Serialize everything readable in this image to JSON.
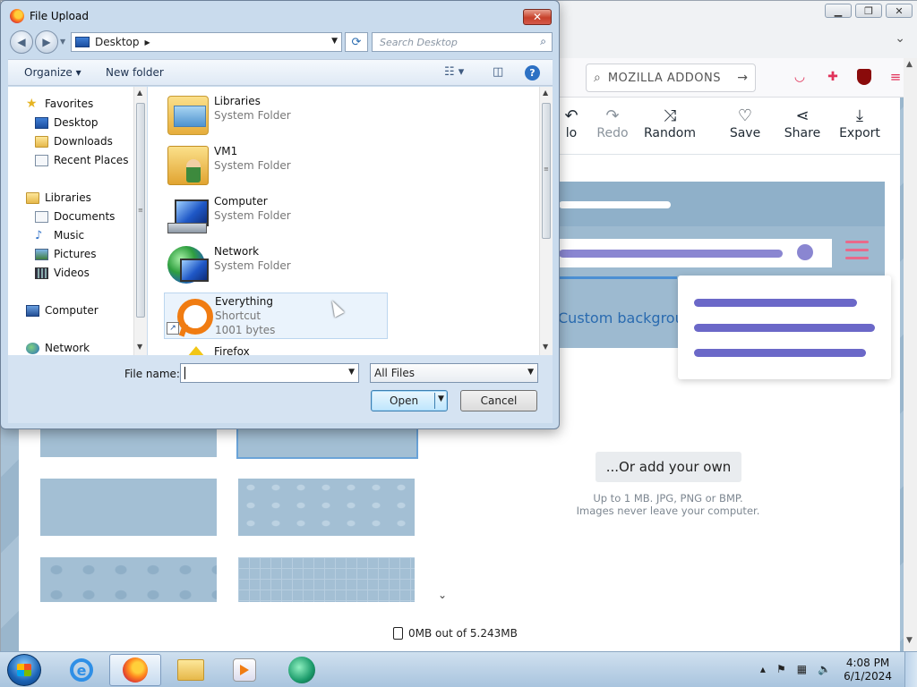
{
  "dialog": {
    "title": "File Upload",
    "breadcrumb": "Desktop",
    "search_placeholder": "Search Desktop",
    "organize_label": "Organize ▾",
    "new_folder_label": "New folder",
    "nav_pane": {
      "favorites": "Favorites",
      "favorites_items": [
        "Desktop",
        "Downloads",
        "Recent Places"
      ],
      "libraries": "Libraries",
      "libraries_items": [
        "Documents",
        "Music",
        "Pictures",
        "Videos"
      ],
      "computer": "Computer",
      "network": "Network"
    },
    "files": [
      {
        "name": "Libraries",
        "sub": "System Folder",
        "icon": "libraries-icon"
      },
      {
        "name": "VM1",
        "sub": "System Folder",
        "icon": "user-folder-icon"
      },
      {
        "name": "Computer",
        "sub": "System Folder",
        "icon": "computer-icon"
      },
      {
        "name": "Network",
        "sub": "System Folder",
        "icon": "network-icon"
      },
      {
        "name": "Everything",
        "sub": "Shortcut",
        "sub2": "1001 bytes",
        "icon": "everything-icon"
      },
      {
        "name": "Firefox",
        "sub": "",
        "icon": "firefox-icon"
      }
    ],
    "file_name_label": "File name:",
    "file_name_value": "",
    "file_type": "All Files",
    "open_label": "Open",
    "cancel_label": "Cancel"
  },
  "browser": {
    "url_text": "MOZILLA ADDONS",
    "toolbar": [
      {
        "label": "lo",
        "glyph": "↶",
        "disabled": false
      },
      {
        "label": "Redo",
        "glyph": "↷",
        "disabled": true
      },
      {
        "label": "Random",
        "glyph": "⤨",
        "disabled": false
      },
      {
        "label": "Save",
        "glyph": "♡",
        "disabled": false
      },
      {
        "label": "Share",
        "glyph": "⋖",
        "disabled": false
      },
      {
        "label": "Export",
        "glyph": "⤓",
        "disabled": false
      }
    ],
    "custom_background_title": "Custom backgroun",
    "add_own_label": "...Or add your own",
    "add_hint_line1": "Up to 1 MB. JPG, PNG or BMP.",
    "add_hint_line2": "Images never leave your computer.",
    "storage_text": "0MB out of 5.243MB"
  },
  "taskbar": {
    "time": "4:08 PM",
    "date": "6/1/2024"
  },
  "colors": {
    "accent_purple": "#8a86d1",
    "menu_pink": "#e9698a",
    "link_blue": "#2a6bb0",
    "page_blue": "#a9c2d6"
  }
}
